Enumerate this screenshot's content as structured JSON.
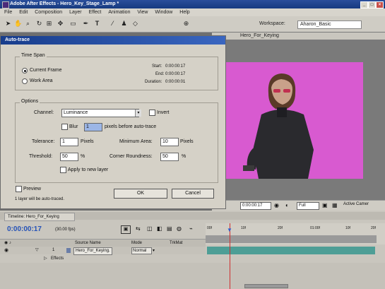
{
  "app": {
    "title": "Adobe After Effects - Hero_Key_Stage_Lamp *",
    "menu": [
      "File",
      "Edit",
      "Composition",
      "Layer",
      "Effect",
      "Animation",
      "View",
      "Window",
      "Help"
    ],
    "workspace_label": "Workspace:",
    "workspace_value": "Aharon_Basic"
  },
  "comp": {
    "tab_label": "Hero_For_Keying",
    "timecode": "0:00:00:17",
    "resolution": "Full",
    "camera": "Active Camer"
  },
  "dialog": {
    "title": "Auto-trace",
    "timespan_label": "Time Span",
    "current_frame": "Current Frame",
    "work_area": "Work Area",
    "start_label": "Start:",
    "start_value": "0:00:00:17",
    "end_label": "End:",
    "end_value": "0:00:00:17",
    "duration_label": "Duration:",
    "duration_value": "0:00:00:01",
    "options_label": "Options",
    "channel_label": "Channel:",
    "channel_value": "Luminance",
    "invert_label": "Invert",
    "blur_label": "Blur",
    "blur_value": "1",
    "blur_suffix": "pixels before auto-trace",
    "tolerance_label": "Tolerance:",
    "tolerance_value": "1",
    "tolerance_unit": "Pixels",
    "min_area_label": "Minimum Area:",
    "min_area_value": "10",
    "min_area_unit": "Pixels",
    "threshold_label": "Threshold:",
    "threshold_value": "50",
    "threshold_unit": "%",
    "corner_label": "Corner Roundness:",
    "corner_value": "50",
    "corner_unit": "%",
    "apply_label": "Apply to new layer",
    "preview_label": "Preview",
    "status": "1 layer will be auto-traced.",
    "ok": "OK",
    "cancel": "Cancel"
  },
  "timeline": {
    "tab_label": "Timeline: Hero_For_Keying",
    "timecode": "0:00:00:17",
    "fps": "(30.00 fps)",
    "col_source": "Source Name",
    "col_mode": "Mode",
    "col_trkmat": "TrkMat",
    "layer_num": "1",
    "layer_name": "Hero_For_Keying.",
    "layer_mode": "Normal",
    "effects_label": "Effects",
    "ruler_ticks": [
      "00f",
      "10f",
      "20f",
      "01:00f",
      "10f",
      "20f"
    ]
  },
  "colors": {
    "accent_blue": "#2653b8",
    "comp_bg": "#d85ad0",
    "layer_bar": "#4e9e96",
    "cti": "#d03030"
  }
}
